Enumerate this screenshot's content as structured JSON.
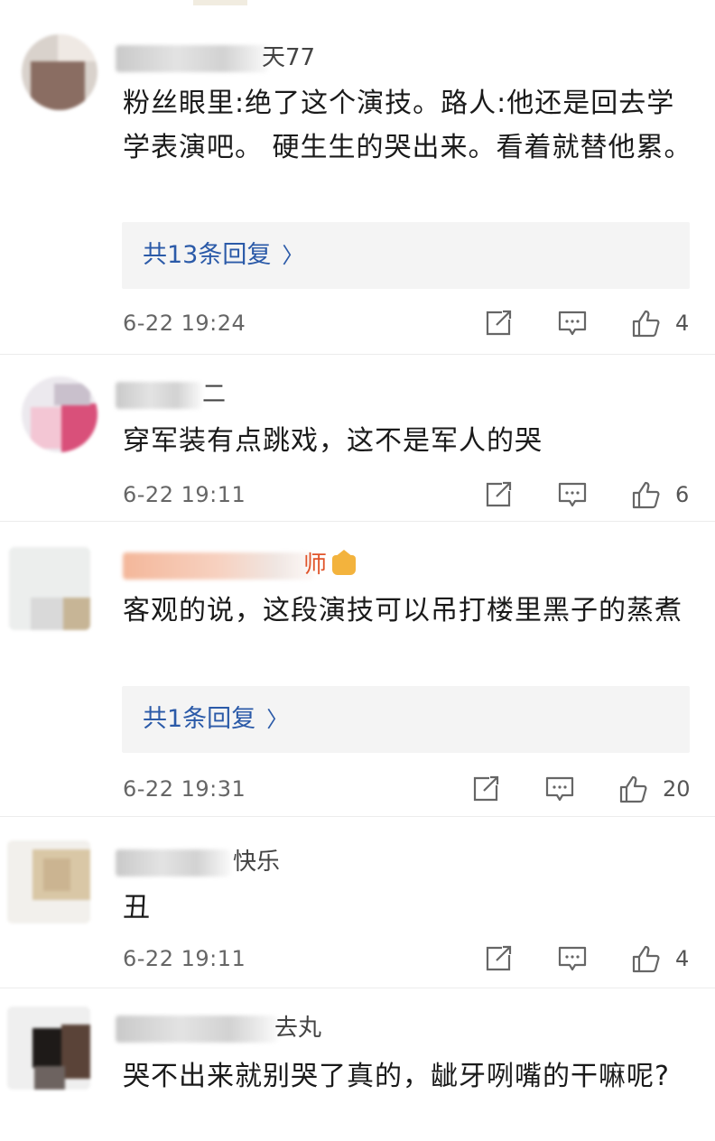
{
  "comments": [
    {
      "name_suffix": "天77",
      "text": "粉丝眼里:绝了这个演技。路人:他还是回去学学表演吧。 硬生生的哭出来。看着就替他累。",
      "reply": "共13条回复",
      "time": "6-22 19:24",
      "likes": "4"
    },
    {
      "name_suffix": "二",
      "text": "穿军装有点跳戏，这不是军人的哭",
      "time": "6-22 19:11",
      "likes": "6"
    },
    {
      "name_suffix": "师",
      "text": "客观的说，这段演技可以吊打楼里黑子的蒸煮",
      "reply": "共1条回复",
      "time": "6-22 19:31",
      "likes": "20"
    },
    {
      "name_suffix": "快乐",
      "text": "丑",
      "time": "6-22 19:11",
      "likes": "4"
    },
    {
      "name_suffix": "去丸",
      "text": "哭不出来就别哭了真的，龇牙咧嘴的干嘛呢?"
    }
  ],
  "icons": {
    "share": "share-icon",
    "comment": "comment-icon",
    "like": "thumbs-up-icon",
    "reply_chevron": "chevron-right-icon"
  },
  "colors": {
    "link": "#2b5aa8",
    "reply_bg": "#f4f4f4",
    "vip_name": "#e0542a"
  }
}
